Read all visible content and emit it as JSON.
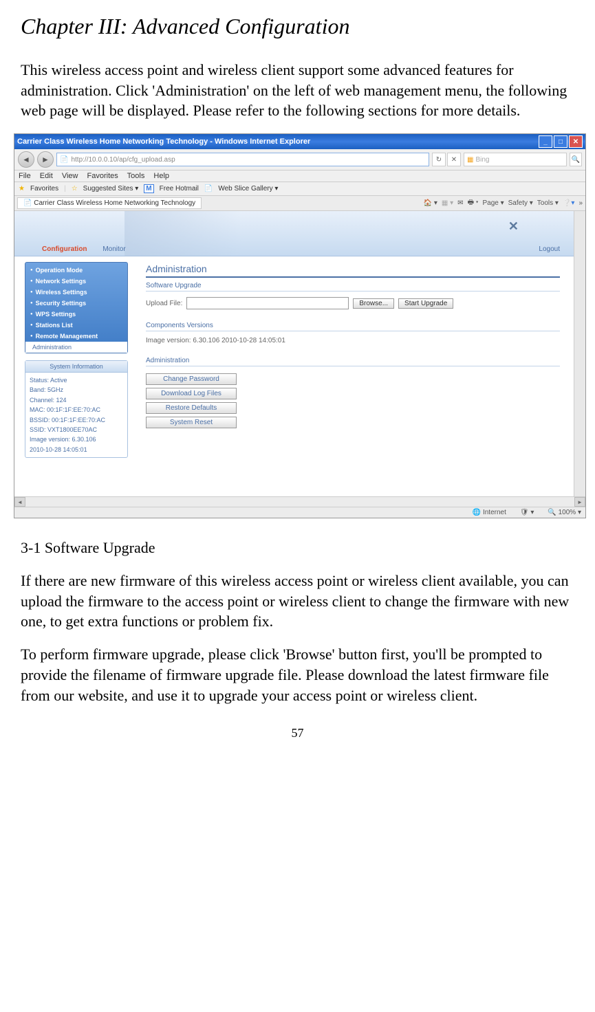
{
  "chapter_title": "Chapter III: Advanced Configuration",
  "intro_text": "This wireless access point and wireless client support some advanced features for administration. Click 'Administration' on the left of web management menu, the following web page will be displayed. Please refer to the following sections for more details.",
  "section_title": "3-1 Software Upgrade",
  "para1": "If there are new firmware of this wireless access point or wireless client available, you can upload the firmware to the access point or wireless client to change the firmware with new one, to get extra functions or problem fix.",
  "para2": "To perform firmware upgrade, please click 'Browse' button first, you'll be prompted to provide the filename of firmware upgrade file. Please download the latest firmware file from our website, and use it to upgrade your access point or wireless client.",
  "page_number": "57",
  "browser": {
    "window_title": "Carrier Class Wireless Home Networking Technology - Windows Internet Explorer",
    "url": "http://10.0.0.10/ap/cfg_upload.asp",
    "search_placeholder": "Bing",
    "menus": [
      "File",
      "Edit",
      "View",
      "Favorites",
      "Tools",
      "Help"
    ],
    "favorites_label": "Favorites",
    "fav_items": [
      "Suggested Sites ▾",
      "Free Hotmail",
      "Web Slice Gallery ▾"
    ],
    "tab_label": "Carrier Class Wireless Home Networking Technology",
    "toolbar_items": [
      "Page ▾",
      "Safety ▾",
      "Tools ▾"
    ],
    "status_internet": "Internet",
    "zoom": "100%"
  },
  "webpage": {
    "banner_tab_config": "Configuration",
    "banner_tab_monitor": "Monitor",
    "logout": "Logout",
    "nav_items": [
      "Operation Mode",
      "Network Settings",
      "Wireless Settings",
      "Security Settings",
      "WPS Settings",
      "Stations List",
      "Remote Management"
    ],
    "nav_active": "Administration",
    "sysinfo_title": "System Information",
    "sysinfo": {
      "status": "Status: Active",
      "band": "Band: 5GHz",
      "channel": "Channel: 124",
      "mac": "MAC: 00:1F:1F:EE:70:AC",
      "bssid": "BSSID: 00:1F:1F:EE:70:AC",
      "ssid": "SSID: VXT1800EE70AC",
      "image": "Image version: 6.30.106",
      "date": "2010-10-28 14:05:01"
    },
    "content_title": "Administration",
    "soft_upgrade": "Software Upgrade",
    "upload_label": "Upload File:",
    "browse": "Browse...",
    "start_upgrade": "Start Upgrade",
    "comp_versions": "Components Versions",
    "version_line": "Image version:  6.30.106 2010-10-28 14:05:01",
    "admin_sub": "Administration",
    "admin_buttons": [
      "Change Password",
      "Download Log Files",
      "Restore Defaults",
      "System Reset"
    ]
  }
}
